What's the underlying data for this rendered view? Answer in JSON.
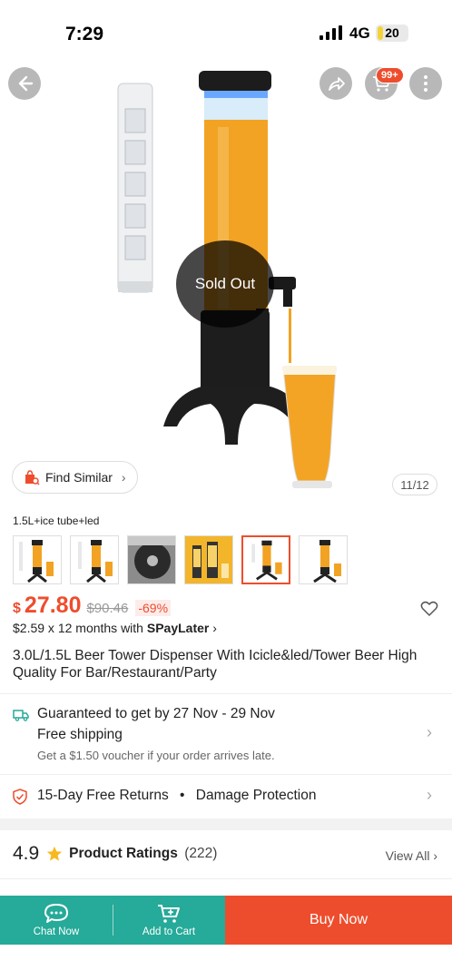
{
  "status_bar": {
    "time": "7:29",
    "network": "4G",
    "battery": "20",
    "battery_level": 0.2
  },
  "gallery": {
    "sold_out": "Sold Out",
    "find_similar": "Find Similar",
    "page_indicator": "11/12",
    "cart_badge": "99+"
  },
  "variations": {
    "selected_label": "1.5L+ice tube+led",
    "thumbnails": [
      "thumb-1",
      "thumb-2",
      "thumb-3",
      "thumb-4",
      "thumb-5",
      "thumb-6"
    ],
    "selected_index": 4
  },
  "price": {
    "currency": "$",
    "current": "27.80",
    "original": "$90.46",
    "discount": "-69%",
    "installment": "$2.59 x 12 months with",
    "installment_brand": "SPayLater"
  },
  "product": {
    "title": "3.0L/1.5L Beer Tower Dispenser With Icicle&led/Tower Beer High Quality For Bar/Restaurant/Party"
  },
  "shipping": {
    "guarantee": "Guaranteed to get by 27 Nov - 29 Nov",
    "free_shipping": "Free shipping",
    "voucher_note": "Get a $1.50 voucher if your order arrives late."
  },
  "returns": {
    "text": "15-Day Free Returns",
    "protection": "Damage Protection"
  },
  "ratings": {
    "score": "4.9",
    "label": "Product Ratings",
    "count": "(222)",
    "view_all": "View All"
  },
  "bottom_bar": {
    "chat": "Chat Now",
    "add_to_cart": "Add to Cart",
    "buy_now": "Buy Now"
  },
  "colors": {
    "brand": "#ee4d2d",
    "teal": "#26aa99"
  }
}
